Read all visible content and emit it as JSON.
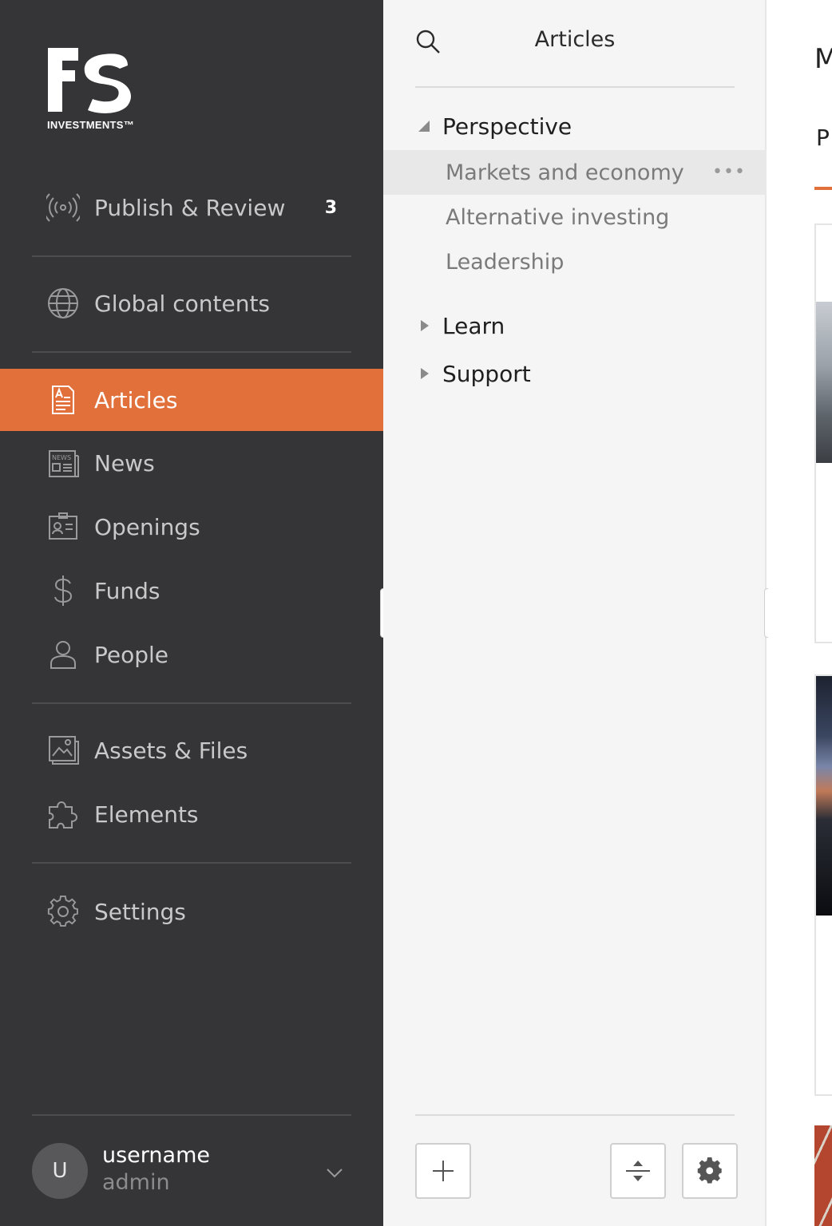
{
  "sidebar": {
    "logo": {
      "wordmark": "FS",
      "tagline": "INVESTMENTS™"
    },
    "items": [
      {
        "label": "Publish & Review",
        "icon": "broadcast-icon",
        "badge": "3"
      },
      {
        "label": "Global contents",
        "icon": "globe-icon"
      },
      {
        "label": "Articles",
        "icon": "article-icon",
        "active": true
      },
      {
        "label": "News",
        "icon": "newspaper-icon"
      },
      {
        "label": "Openings",
        "icon": "id-card-icon"
      },
      {
        "label": "Funds",
        "icon": "dollar-icon"
      },
      {
        "label": "People",
        "icon": "person-icon"
      },
      {
        "label": "Assets & Files",
        "icon": "image-icon"
      },
      {
        "label": "Elements",
        "icon": "puzzle-icon"
      },
      {
        "label": "Settings",
        "icon": "gear-icon"
      }
    ],
    "user": {
      "initial": "U",
      "name": "username",
      "role": "admin"
    }
  },
  "tree": {
    "title": "Articles",
    "groups": [
      {
        "label": "Perspective",
        "expanded": true,
        "children": [
          {
            "label": "Markets and economy",
            "selected": true
          },
          {
            "label": "Alternative investing"
          },
          {
            "label": "Leadership"
          }
        ]
      },
      {
        "label": "Learn",
        "expanded": false
      },
      {
        "label": "Support",
        "expanded": false
      }
    ],
    "more_glyph": "•••"
  },
  "content": {
    "title": "M",
    "tab": "P"
  },
  "colors": {
    "sidebar_bg": "#353436",
    "accent": "#e2703a",
    "tree_bg": "#f5f5f5"
  }
}
